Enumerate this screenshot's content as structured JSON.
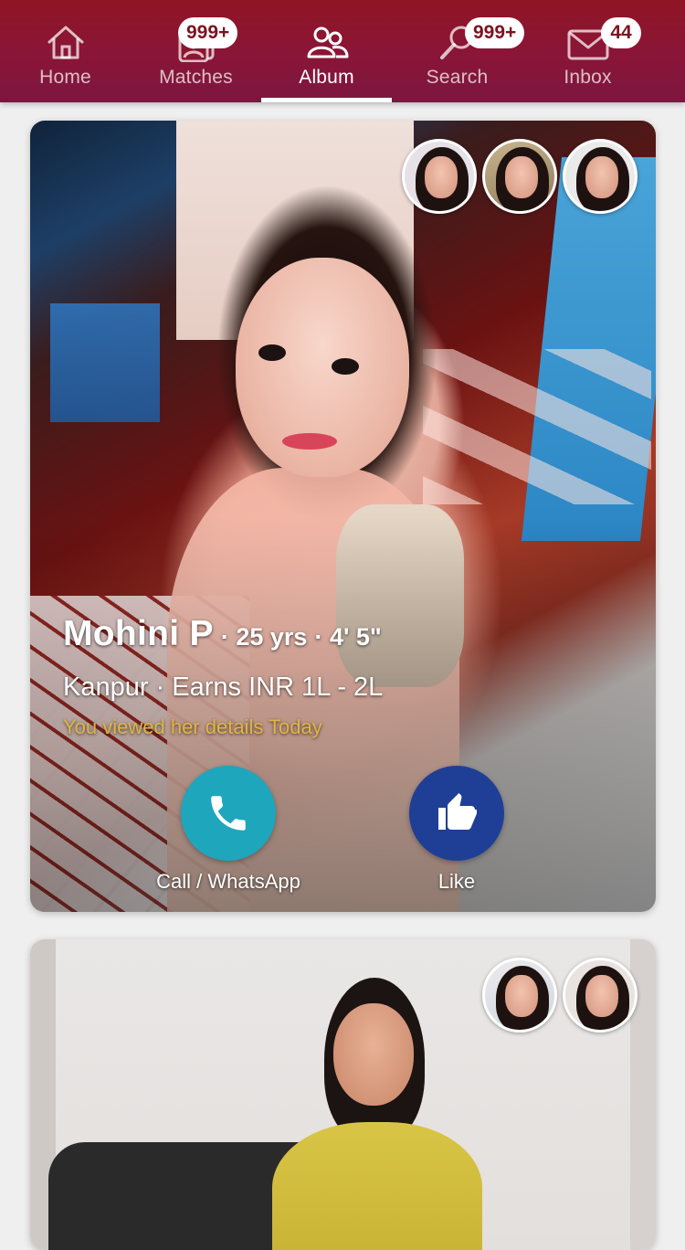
{
  "nav": {
    "tabs": [
      {
        "label": "Home",
        "icon": "home-icon"
      },
      {
        "label": "Matches",
        "icon": "matches-icon",
        "badge": "999+"
      },
      {
        "label": "Album",
        "icon": "album-icon",
        "active": true
      },
      {
        "label": "Search",
        "icon": "search-icon",
        "badge": "999+"
      },
      {
        "label": "Inbox",
        "icon": "inbox-icon",
        "badge": "44"
      }
    ]
  },
  "profiles": [
    {
      "name": "Mohini P",
      "age": "· 25 yrs",
      "height": "· 4' 5\"",
      "location_income": "Kanpur · Earns INR 1L - 2L",
      "viewed_status": "You viewed her details Today",
      "call_label": "Call / WhatsApp",
      "like_label": "Like",
      "thumbnail_count": 3
    },
    {
      "thumbnail_count": 2
    }
  ],
  "colors": {
    "nav_bg": "#8a1538",
    "badge_text": "#7c1322",
    "call_button": "#1ea6bd",
    "like_button": "#1f3f97",
    "viewed_text": "#e3b53f"
  }
}
